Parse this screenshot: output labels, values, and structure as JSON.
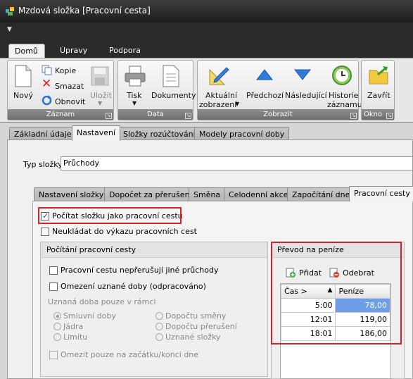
{
  "window": {
    "title": "Mzdová složka [Pracovní cesta]"
  },
  "ribbon": {
    "tabs": [
      "Domů",
      "Úpravy",
      "Podpora"
    ],
    "groups": {
      "zaznam": {
        "title": "Záznam",
        "novy": "Nový",
        "kopie": "Kopie",
        "smazat": "Smazat",
        "obnovit": "Obnovit",
        "ulozit": "Uložit"
      },
      "data": {
        "title": "Data",
        "tisk": "Tisk",
        "dokumenty": "Dokumenty"
      },
      "zobrazit": {
        "title": "Zobrazit",
        "aktualni1": "Aktuální",
        "aktualni2": "zobrazení",
        "predchozi": "Předchozí",
        "nasledujici": "Následující",
        "historie1": "Historie",
        "historie2": "záznamu"
      },
      "okno": {
        "title": "Okno",
        "zavrit": "Zavřít"
      }
    }
  },
  "main_tabs": [
    "Základní údaje",
    "Nastavení",
    "Složky rozúčtování",
    "Modely pracovní doby"
  ],
  "typ_slozky": {
    "label": "Typ složky",
    "value": "Průchody"
  },
  "sub_tabs": [
    "Nastavení složky",
    "Dopočet za přerušení",
    "Směna",
    "Celodenní akce",
    "Započítání dne",
    "Pracovní cesty"
  ],
  "checkboxes": {
    "pocitat": "Počítat složku jako pracovní cestu",
    "neukladat": "Neukládat do výkazu pracovních cest"
  },
  "pocitani": {
    "title": "Počítání pracovní cesty",
    "neprerusuji": "Pracovní cestu nepřerušují jiné průchody",
    "omezeni": "Omezení uznané doby (odpracováno)",
    "uznana_label": "Uznaná doba pouze v rámci",
    "radios_left": [
      "Smluvní doby",
      "Jádra",
      "Limitu"
    ],
    "radios_right": [
      "Dopočtu směny",
      "Dopočtu přerušení",
      "Uznané složky"
    ],
    "omezit": "Omezit pouze na začátku/konci dne"
  },
  "prevod": {
    "title": "Převod na peníze",
    "pridat": "Přidat",
    "odebrat": "Odebrat",
    "col_cas": "Čas >",
    "col_penize": "Peníze",
    "rows": [
      {
        "cas": "5:00",
        "penize": "78,00"
      },
      {
        "cas": "12:01",
        "penize": "119,00"
      },
      {
        "cas": "18:01",
        "penize": "186,00"
      }
    ]
  }
}
